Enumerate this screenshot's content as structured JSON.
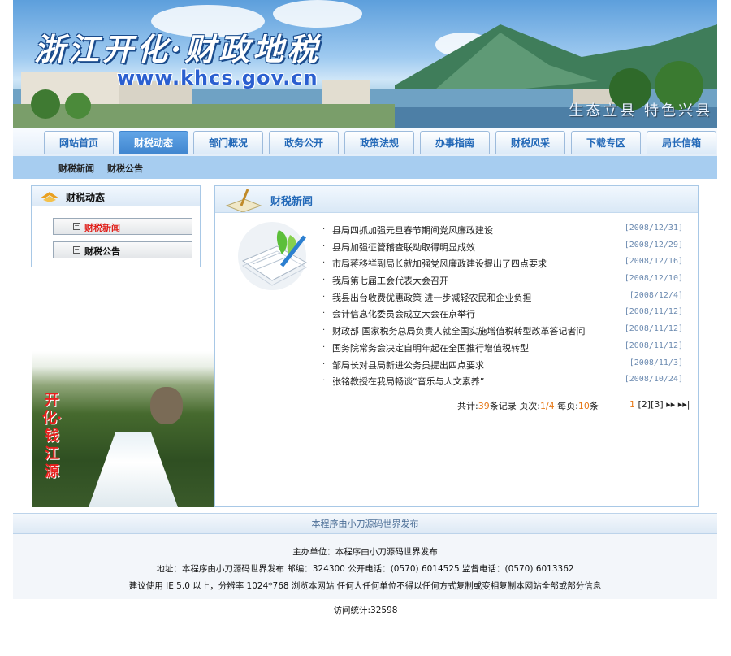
{
  "banner": {
    "title": "浙江开化·财政地税",
    "url": "www.khcs.gov.cn",
    "slogan": "生态立县 特色兴县"
  },
  "nav": {
    "tabs": [
      "网站首页",
      "财税动态",
      "部门概况",
      "政务公开",
      "政策法规",
      "办事指南",
      "财税风采",
      "下载专区",
      "局长信箱"
    ],
    "active": "财税动态"
  },
  "subnav": [
    "财税新闻",
    "财税公告"
  ],
  "sidebar": {
    "title": "财税动态",
    "items": [
      {
        "label": "财税新闻",
        "color": "#e0201b"
      },
      {
        "label": "财税公告",
        "color": "#111111"
      }
    ]
  },
  "photo": {
    "caption": "开化·钱江源"
  },
  "main": {
    "title": "财税新闻",
    "news": [
      {
        "title": "县局四抓加强元旦春节期间党风廉政建设",
        "date": "[2008/12/31]"
      },
      {
        "title": "县局加强征管稽查联动取得明显成效",
        "date": "[2008/12/29]"
      },
      {
        "title": "市局蒋移祥副局长就加强党风廉政建设提出了四点要求",
        "date": "[2008/12/16]"
      },
      {
        "title": "我局第七届工会代表大会召开",
        "date": "[2008/12/10]"
      },
      {
        "title": "我县出台收费优惠政策 进一步减轻农民和企业负担",
        "date": "[2008/12/4]"
      },
      {
        "title": "会计信息化委员会成立大会在京举行",
        "date": "[2008/11/12]"
      },
      {
        "title": "财政部 国家税务总局负责人就全国实施增值税转型改革答记者问",
        "date": "[2008/11/12]"
      },
      {
        "title": "国务院常务会决定自明年起在全国推行增值税转型",
        "date": "[2008/11/12]"
      },
      {
        "title": "邹局长对县局新进公务员提出四点要求",
        "date": "[2008/11/3]"
      },
      {
        "title": "张铭教授在我局畅谈“音乐与人文素养”",
        "date": "[2008/10/24]"
      }
    ],
    "pager": {
      "total_label": "共计:",
      "total": "39",
      "records_label": "条记录",
      "page_label": "页次:",
      "page": "1/4",
      "per_label": "每页:",
      "per": "10",
      "per_unit": "条",
      "pages": [
        "1",
        "[2]",
        "[3]",
        "▸▸",
        "▸▸|"
      ]
    }
  },
  "footer": {
    "bar": "本程序由小刀源码世界发布",
    "line1": "主办单位：本程序由小刀源码世界发布",
    "line2": "地址：本程序由小刀源码世界发布    邮编：324300    公开电话：(0570) 6014525    监督电话：(0570) 6013362",
    "line3": "建议使用 IE 5.0 以上，分辨率 1024*768 浏览本网站    任何人任何单位不得以任何方式复制或变相复制本网站全部或部分信息",
    "visits": "访问统计:32598"
  },
  "colors": {
    "accent": "#2369b8",
    "active_tab": "#3f85cf",
    "subnav": "#a7cdf0",
    "date": "#6b8ab0",
    "highlight": "#e67817"
  }
}
